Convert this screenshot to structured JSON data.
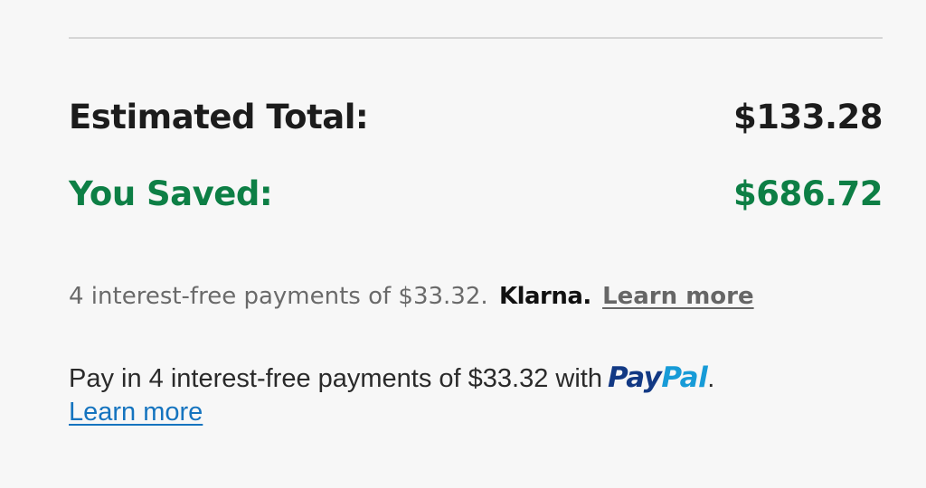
{
  "summary": {
    "total_label": "Estimated Total:",
    "total_value": "$133.28",
    "saved_label": "You Saved:",
    "saved_value": "$686.72"
  },
  "klarna": {
    "text": "4 interest-free payments of $33.32.",
    "logo_text": "Klarna.",
    "link": "Learn more"
  },
  "paypal": {
    "text": "Pay in 4 interest-free payments of $33.32 with",
    "logo_pay": "Pay",
    "logo_pal": "Pal",
    "suffix": ".",
    "link": "Learn more"
  },
  "colors": {
    "saved_green": "#0d7f45",
    "paypal_dark_blue": "#123984",
    "paypal_light_blue": "#179bd7",
    "link_blue": "#1574bf"
  }
}
